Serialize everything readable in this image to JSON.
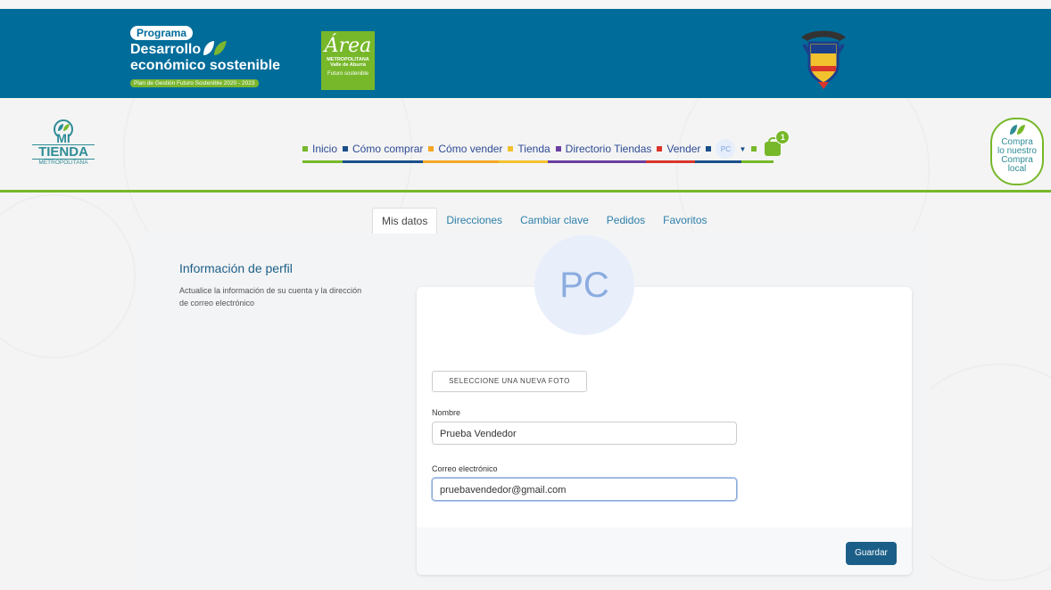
{
  "topbar": {
    "programa": "Programa",
    "desarrollo": "Desarrollo",
    "economico": "económico sostenible",
    "plan": "Plan de Gestión Futuro Sostenible 2020 - 2023",
    "area_name": "Área",
    "area_metro": "METROPOLITANA",
    "area_valle": "Valle de Aburrá",
    "area_futuro": "Futuro sostenible"
  },
  "header": {
    "logo_mi": "MI",
    "logo_tienda": "TIENDA",
    "logo_metro": "METROPOLITANA",
    "compra_line1": "Compra",
    "compra_line2": "lo nuestro",
    "compra_line3": "Compra",
    "compra_line4": "local",
    "cart_count": "1",
    "user_initials": "PC"
  },
  "nav": {
    "items": [
      {
        "label": "Inicio",
        "color": "#77b82a"
      },
      {
        "label": "Cómo comprar",
        "color": "#1b4f8a"
      },
      {
        "label": "Cómo vender",
        "color": "#f5a623"
      },
      {
        "label": "Tienda",
        "color": "#f2c12e"
      },
      {
        "label": "Directorio Tiendas",
        "color": "#6b3fa0"
      },
      {
        "label": "Vender",
        "color": "#d9352b"
      }
    ],
    "extra_colors": [
      "#1b4f8a",
      "#77b82a"
    ]
  },
  "tabs": [
    {
      "label": "Mis datos",
      "active": true
    },
    {
      "label": "Direcciones"
    },
    {
      "label": "Cambiar clave"
    },
    {
      "label": "Pedidos"
    },
    {
      "label": "Favoritos"
    }
  ],
  "profile": {
    "title": "Información de perfil",
    "description": "Actualice la información de su cuenta y la dirección de correo electrónico",
    "avatar_initials": "PC",
    "photo_button": "SELECCIONE UNA NUEVA FOTO",
    "name_label": "Nombre",
    "name_value": "Prueba Vendedor",
    "email_label": "Correo electrónico",
    "email_value": "pruebavendedor@gmail.com",
    "save_button": "Guardar"
  },
  "colors": {
    "gov_blue": "#006c9a",
    "brand_green": "#77b82a",
    "save_blue": "#1b5f88"
  }
}
